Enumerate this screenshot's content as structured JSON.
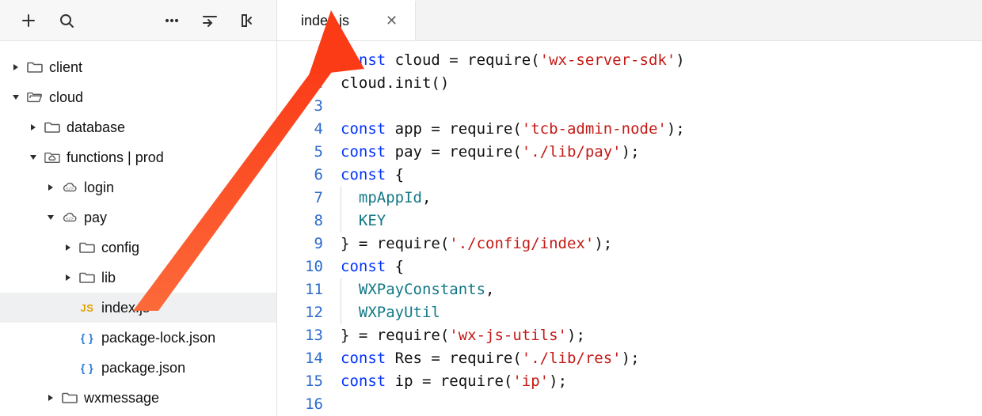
{
  "tab": {
    "label": "index.js"
  },
  "tree": [
    {
      "depth": 0,
      "type": "folder",
      "open": false,
      "label": "client"
    },
    {
      "depth": 0,
      "type": "folder-open",
      "open": true,
      "label": "cloud"
    },
    {
      "depth": 1,
      "type": "folder",
      "open": false,
      "label": "database"
    },
    {
      "depth": 1,
      "type": "cloud-folder",
      "open": true,
      "label": "functions | prod"
    },
    {
      "depth": 2,
      "type": "cloud",
      "open": false,
      "label": "login"
    },
    {
      "depth": 2,
      "type": "cloud",
      "open": true,
      "label": "pay"
    },
    {
      "depth": 3,
      "type": "folder",
      "open": false,
      "label": "config"
    },
    {
      "depth": 3,
      "type": "folder",
      "open": false,
      "label": "lib"
    },
    {
      "depth": 3,
      "type": "js",
      "selected": true,
      "label": "index.js"
    },
    {
      "depth": 3,
      "type": "json",
      "label": "package-lock.json"
    },
    {
      "depth": 3,
      "type": "json",
      "label": "package.json"
    },
    {
      "depth": 2,
      "type": "folder",
      "open": false,
      "label": "wxmessage"
    }
  ],
  "code_lines": 16,
  "colors": {
    "keyword": "#0433ff",
    "string": "#c41a16",
    "identifier": "#137886",
    "gutter": "#2c6acc",
    "arrow": "#fc4a22"
  },
  "source": {
    "file": "index.js",
    "lines": [
      "const cloud = require('wx-server-sdk')",
      "cloud.init()",
      "",
      "const app = require('tcb-admin-node');",
      "const pay = require('./lib/pay');",
      "const {",
      "  mpAppId,",
      "  KEY",
      "} = require('./config/index');",
      "const {",
      "  WXPayConstants,",
      "  WXPayUtil",
      "} = require('wx-js-utils');",
      "const Res = require('./lib/res');",
      "const ip = require('ip');",
      ""
    ]
  }
}
